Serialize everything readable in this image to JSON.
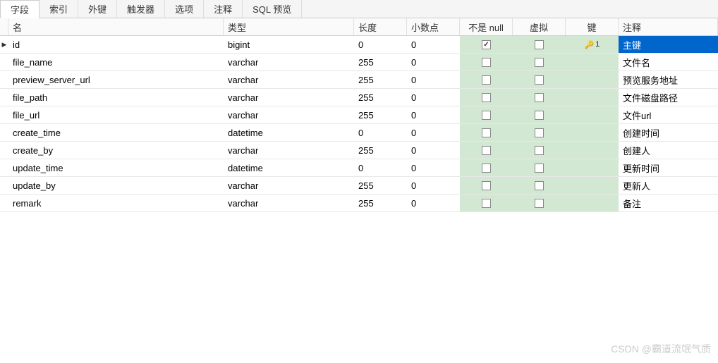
{
  "tabs": [
    {
      "label": "字段",
      "active": true
    },
    {
      "label": "索引",
      "active": false
    },
    {
      "label": "外键",
      "active": false
    },
    {
      "label": "触发器",
      "active": false
    },
    {
      "label": "选项",
      "active": false
    },
    {
      "label": "注释",
      "active": false
    },
    {
      "label": "SQL 预览",
      "active": false
    }
  ],
  "headers": {
    "name": "名",
    "type": "类型",
    "length": "长度",
    "decimal": "小数点",
    "notnull": "不是 null",
    "virtual": "虚拟",
    "key": "键",
    "comment": "注释"
  },
  "rows": [
    {
      "selected": true,
      "name": "id",
      "type": "bigint",
      "len": "0",
      "dec": "0",
      "notnull": true,
      "virtual": false,
      "key": "1",
      "comment": "主键"
    },
    {
      "selected": false,
      "name": "file_name",
      "type": "varchar",
      "len": "255",
      "dec": "0",
      "notnull": false,
      "virtual": false,
      "key": "",
      "comment": "文件名"
    },
    {
      "selected": false,
      "name": "preview_server_url",
      "type": "varchar",
      "len": "255",
      "dec": "0",
      "notnull": false,
      "virtual": false,
      "key": "",
      "comment": "预览服务地址"
    },
    {
      "selected": false,
      "name": "file_path",
      "type": "varchar",
      "len": "255",
      "dec": "0",
      "notnull": false,
      "virtual": false,
      "key": "",
      "comment": "文件磁盘路径"
    },
    {
      "selected": false,
      "name": "file_url",
      "type": "varchar",
      "len": "255",
      "dec": "0",
      "notnull": false,
      "virtual": false,
      "key": "",
      "comment": "文件url"
    },
    {
      "selected": false,
      "name": "create_time",
      "type": "datetime",
      "len": "0",
      "dec": "0",
      "notnull": false,
      "virtual": false,
      "key": "",
      "comment": "创建时间"
    },
    {
      "selected": false,
      "name": "create_by",
      "type": "varchar",
      "len": "255",
      "dec": "0",
      "notnull": false,
      "virtual": false,
      "key": "",
      "comment": "创建人"
    },
    {
      "selected": false,
      "name": "update_time",
      "type": "datetime",
      "len": "0",
      "dec": "0",
      "notnull": false,
      "virtual": false,
      "key": "",
      "comment": "更新时间"
    },
    {
      "selected": false,
      "name": "update_by",
      "type": "varchar",
      "len": "255",
      "dec": "0",
      "notnull": false,
      "virtual": false,
      "key": "",
      "comment": "更新人"
    },
    {
      "selected": false,
      "name": "remark",
      "type": "varchar",
      "len": "255",
      "dec": "0",
      "notnull": false,
      "virtual": false,
      "key": "",
      "comment": "备注"
    }
  ],
  "watermark": "CSDN @霸道流氓气质"
}
